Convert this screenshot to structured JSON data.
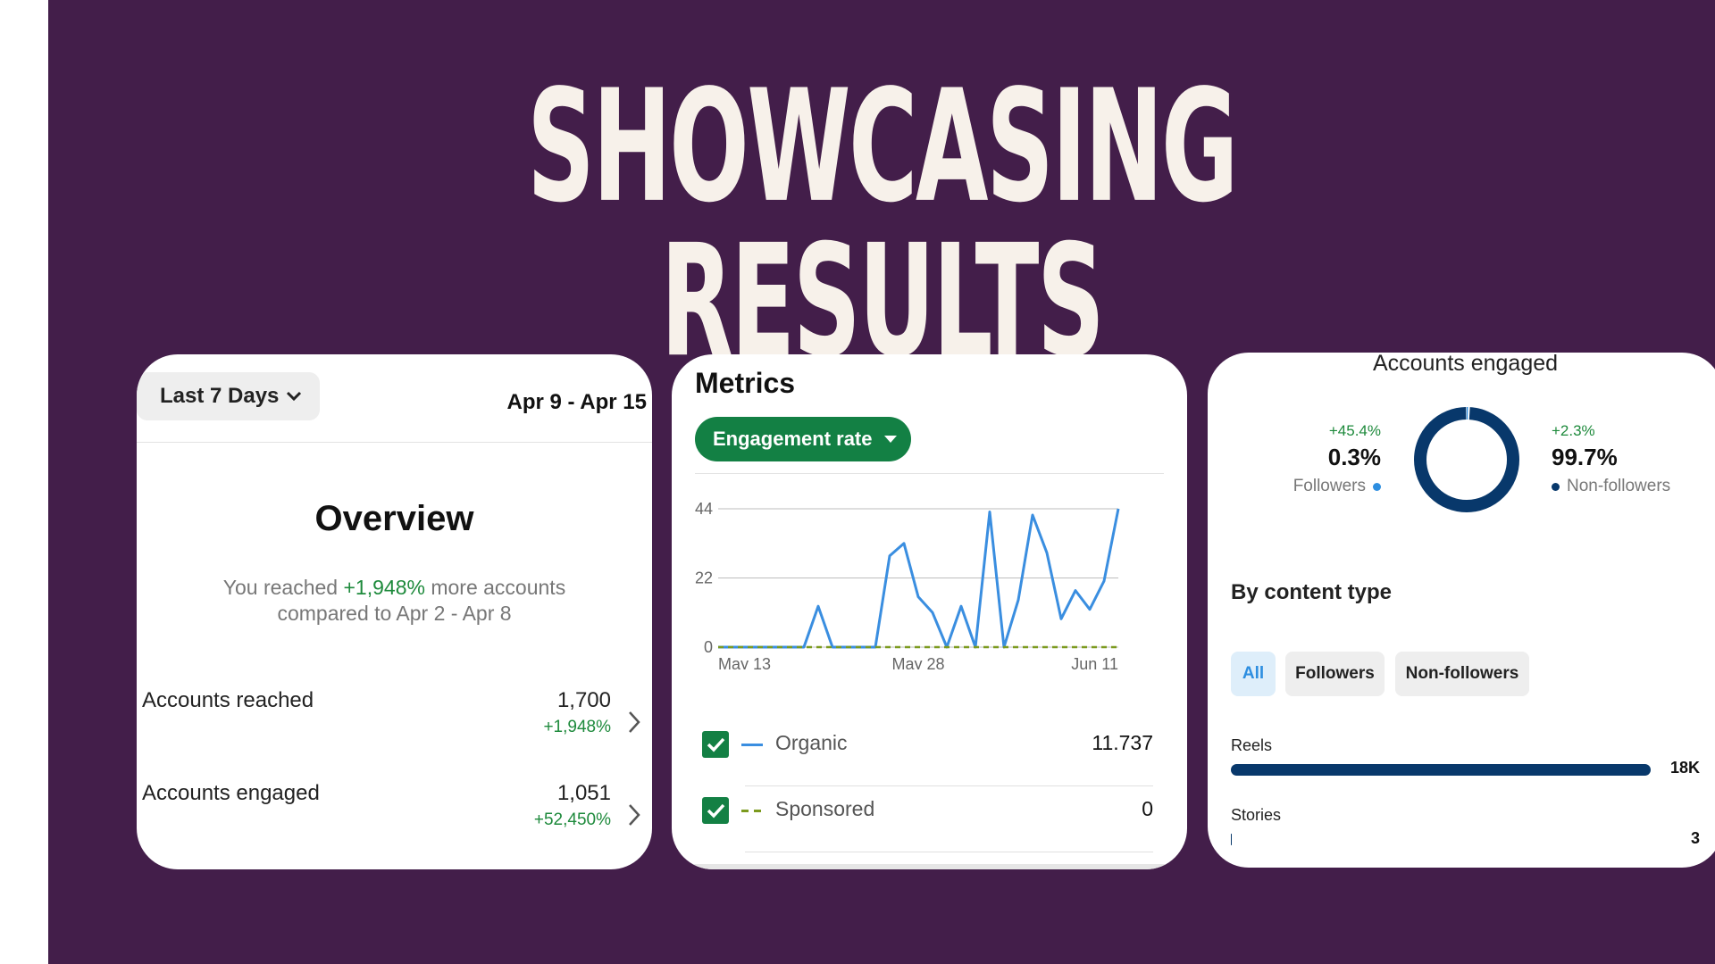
{
  "headline": "SHOWCASING RESULTS",
  "overview": {
    "range_label": "Last 7 Days",
    "date_range": "Apr 9 - Apr 15",
    "title": "Overview",
    "reached_prefix": "You reached ",
    "reached_pct": "+1,948%",
    "reached_suffix": " more accounts",
    "compared": "compared to Apr 2 - Apr 8",
    "rows": [
      {
        "label": "Accounts reached",
        "value": "1,700",
        "change": "+1,948%"
      },
      {
        "label": "Accounts engaged",
        "value": "1,051",
        "change": "+52,450%"
      }
    ]
  },
  "metrics": {
    "title": "Metrics",
    "selector": "Engagement rate",
    "legend": [
      {
        "name": "Organic",
        "value": "11.737"
      },
      {
        "name": "Sponsored",
        "value": "0"
      }
    ]
  },
  "chart_data": {
    "type": "line",
    "x_ticks": [
      "May 13",
      "May 28",
      "Jun 11"
    ],
    "y_ticks": [
      0,
      22,
      44
    ],
    "ylim": [
      0,
      44
    ],
    "grid": true,
    "series": [
      {
        "name": "Organic",
        "color": "#3a8ee0",
        "values": [
          0,
          0,
          0,
          0,
          0,
          0,
          0,
          13,
          0,
          0,
          0,
          0,
          29,
          33,
          16,
          11,
          0,
          13,
          0,
          43,
          0,
          15,
          42,
          30,
          9,
          18,
          12,
          21,
          44
        ]
      },
      {
        "name": "Sponsored",
        "color": "#7c9a1e",
        "values": [
          0,
          0,
          0,
          0,
          0,
          0,
          0,
          0,
          0,
          0,
          0,
          0,
          0,
          0,
          0,
          0,
          0,
          0,
          0,
          0,
          0,
          0,
          0,
          0,
          0,
          0,
          0,
          0,
          0
        ]
      }
    ]
  },
  "engaged": {
    "title": "Accounts engaged",
    "followers": {
      "change": "+45.4%",
      "value": "0.3%",
      "label": "Followers",
      "share": 0.003
    },
    "non_followers": {
      "change": "+2.3%",
      "value": "99.7%",
      "label": "Non-followers",
      "share": 0.997
    },
    "colors": {
      "followers": "#2d8ee0",
      "non_followers": "#08386b"
    },
    "content_title": "By content type",
    "tabs": [
      "All",
      "Followers",
      "Non-followers"
    ],
    "bars": [
      {
        "label": "Reels",
        "value": "18K",
        "share": 1.0
      },
      {
        "label": "Stories",
        "value": "3",
        "share": 0.0002
      }
    ]
  }
}
